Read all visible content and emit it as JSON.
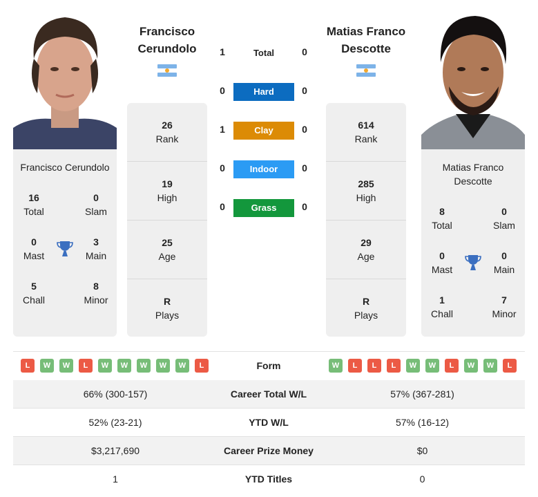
{
  "players": {
    "left": {
      "name": "Francisco Cerundolo",
      "name_lines": [
        "Francisco",
        "Cerundolo"
      ],
      "card_name": "Francisco Cerundolo",
      "flag": "argentina-flag",
      "titles": {
        "total": {
          "value": "16",
          "label": "Total"
        },
        "slam": {
          "value": "0",
          "label": "Slam"
        },
        "mast": {
          "value": "0",
          "label": "Mast"
        },
        "main": {
          "value": "3",
          "label": "Main"
        },
        "chall": {
          "value": "5",
          "label": "Chall"
        },
        "minor": {
          "value": "8",
          "label": "Minor"
        }
      },
      "profile": [
        {
          "value": "26",
          "label": "Rank"
        },
        {
          "value": "19",
          "label": "High"
        },
        {
          "value": "25",
          "label": "Age"
        },
        {
          "value": "R",
          "label": "Plays"
        }
      ]
    },
    "right": {
      "name": "Matias Franco Descotte",
      "name_lines": [
        "Matias Franco",
        "Descotte"
      ],
      "card_name_lines": [
        "Matias Franco",
        "Descotte"
      ],
      "flag": "argentina-flag",
      "titles": {
        "total": {
          "value": "8",
          "label": "Total"
        },
        "slam": {
          "value": "0",
          "label": "Slam"
        },
        "mast": {
          "value": "0",
          "label": "Mast"
        },
        "main": {
          "value": "0",
          "label": "Main"
        },
        "chall": {
          "value": "1",
          "label": "Chall"
        },
        "minor": {
          "value": "7",
          "label": "Minor"
        }
      },
      "profile": [
        {
          "value": "614",
          "label": "Rank"
        },
        {
          "value": "285",
          "label": "High"
        },
        {
          "value": "29",
          "label": "Age"
        },
        {
          "value": "R",
          "label": "Plays"
        }
      ]
    }
  },
  "h2h": {
    "total": {
      "label": "Total",
      "left": "1",
      "right": "0"
    },
    "surfaces": [
      {
        "label": "Hard",
        "left": "0",
        "right": "0",
        "color": "#0c6cc0"
      },
      {
        "label": "Clay",
        "left": "1",
        "right": "0",
        "color": "#dc8b05"
      },
      {
        "label": "Indoor",
        "left": "0",
        "right": "0",
        "color": "#2b9bf4"
      },
      {
        "label": "Grass",
        "left": "0",
        "right": "0",
        "color": "#13973c"
      }
    ]
  },
  "stats": {
    "form": {
      "label": "Form",
      "left": [
        "L",
        "W",
        "W",
        "L",
        "W",
        "W",
        "W",
        "W",
        "W",
        "L"
      ],
      "right": [
        "W",
        "L",
        "L",
        "L",
        "W",
        "W",
        "L",
        "W",
        "W",
        "L"
      ]
    },
    "rows": [
      {
        "label": "Career Total W/L",
        "left": "66% (300-157)",
        "right": "57% (367-281)"
      },
      {
        "label": "YTD W/L",
        "left": "52% (23-21)",
        "right": "57% (16-12)"
      },
      {
        "label": "Career Prize Money",
        "left": "$3,217,690",
        "right": "$0"
      },
      {
        "label": "YTD Titles",
        "left": "1",
        "right": "0"
      }
    ]
  },
  "colors": {
    "win": "#77bd78",
    "loss": "#ec5a45",
    "trophy": "#3b6fc0",
    "card_bg": "#efefef"
  }
}
